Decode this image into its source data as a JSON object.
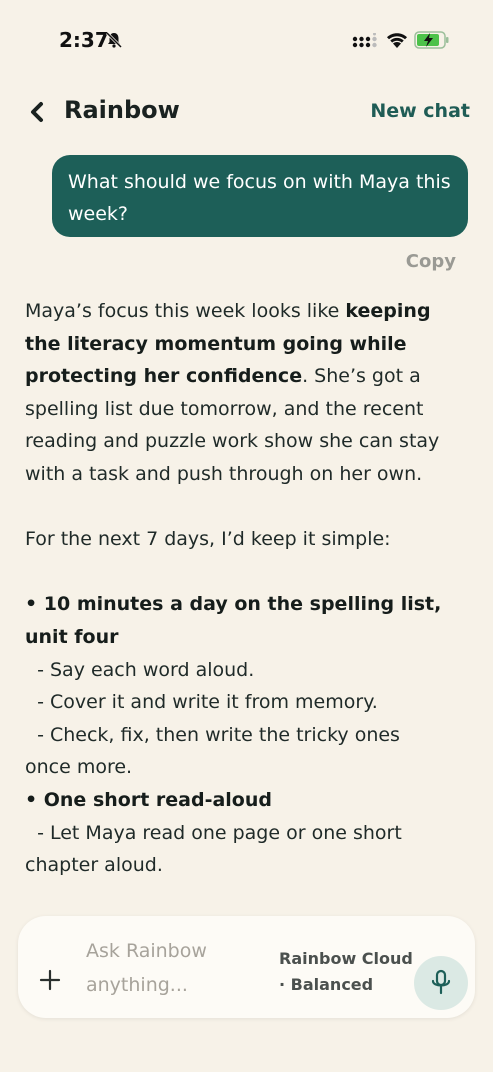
{
  "status_bar": {
    "time": "2:37"
  },
  "header": {
    "title": "Rainbow",
    "new_chat_label": "New chat"
  },
  "messages": {
    "user": {
      "text": "What should we focus on with Maya this week?",
      "copy_label": "Copy"
    },
    "assistant": {
      "p1_a": "Maya’s focus this week looks like ",
      "p1_bold": "keeping the literacy momentum going while protecting her confidence",
      "p1_b": ". She’s got a spelling list due tomorrow, and the recent reading and puzzle work show she can stay with a task and push through on her own.",
      "p2": "For the next 7 days, I’d keep it simple:",
      "bullet1_title": "• 10 minutes a day on the spelling list, unit four",
      "bullet1_items": [
        "  - Say each word aloud.",
        "  - Cover it and write it from memory.",
        "  - Check, fix, then write the tricky ones once more."
      ],
      "bullet2_title": "• One short read-aloud",
      "bullet2_items": [
        "  - Let Maya read one page or one short chapter aloud."
      ]
    }
  },
  "composer": {
    "placeholder": "Ask Rainbow anything...",
    "model_name": "Rainbow Cloud",
    "model_mode": "· Balanced"
  },
  "colors": {
    "background": "#f7f2e8",
    "accent": "#1d5f58",
    "mic_bg": "#dbe9e4"
  }
}
